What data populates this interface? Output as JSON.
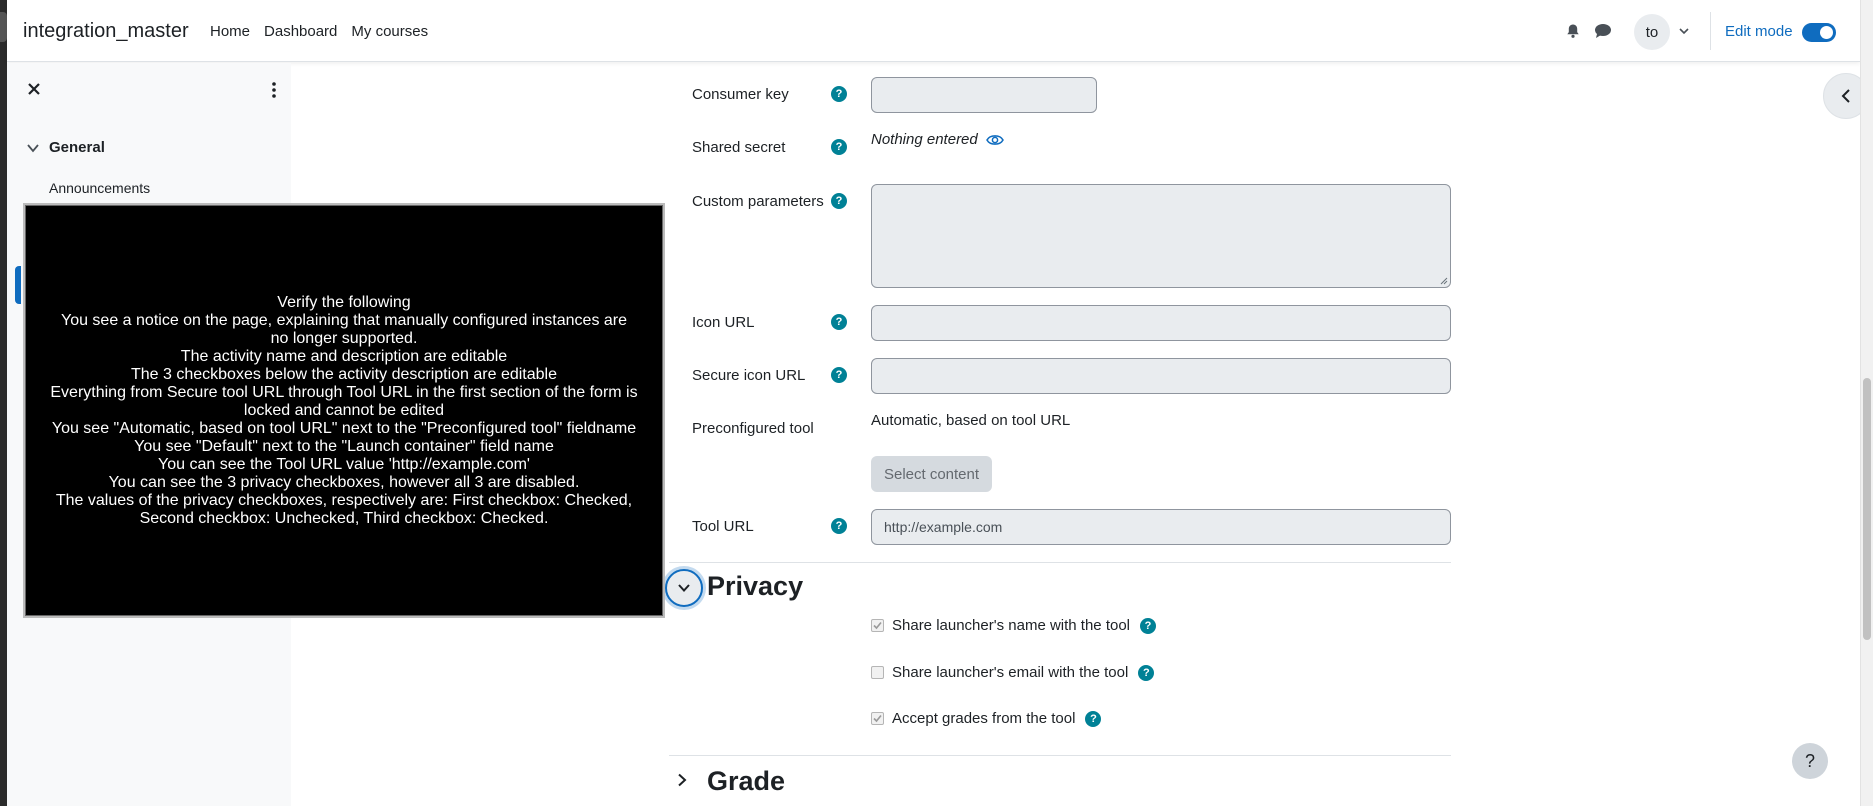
{
  "navbar": {
    "site_name": "integration_master",
    "links": [
      "Home",
      "Dashboard",
      "My courses"
    ],
    "avatar_initials": "to",
    "edit_mode_label": "Edit mode"
  },
  "drawer": {
    "section_label": "General",
    "items": [
      "Announcements"
    ]
  },
  "form": {
    "consumer_key_label": "Consumer key",
    "shared_secret_label": "Shared secret",
    "shared_secret_value": "Nothing entered",
    "custom_parameters_label": "Custom parameters",
    "icon_url_label": "Icon URL",
    "secure_icon_url_label": "Secure icon URL",
    "preconfigured_tool_label": "Preconfigured tool",
    "preconfigured_tool_value": "Automatic, based on tool URL",
    "select_content_label": "Select content",
    "tool_url_label": "Tool URL",
    "tool_url_value": "http://example.com",
    "help_glyph": "?"
  },
  "privacy": {
    "title": "Privacy",
    "checkboxes": [
      {
        "label": "Share launcher's name with the tool",
        "checked": true
      },
      {
        "label": "Share launcher's email with the tool",
        "checked": false
      },
      {
        "label": "Accept grades from the tool",
        "checked": true
      }
    ]
  },
  "grade": {
    "title": "Grade"
  },
  "footer": {
    "help_glyph": "?"
  },
  "overlay": {
    "lines": [
      "Verify the following",
      "You see a notice on the page, explaining that manually configured instances are no longer supported.",
      "The activity name and description are editable",
      "The 3 checkboxes below the activity description are editable",
      "Everything from Secure tool URL through Tool URL in the first section of the form is locked and cannot be edited",
      "You see \"Automatic, based on tool URL\" next to the \"Preconfigured tool\" fieldname",
      "You see \"Default\" next to the \"Launch container\" field name",
      "You can see the Tool URL value 'http://example.com'",
      "You can see the 3 privacy checkboxes, however all 3 are disabled.",
      "The values of the privacy checkboxes, respectively are: First checkbox: Checked, Second checkbox: Unchecked, Third checkbox: Checked."
    ]
  }
}
